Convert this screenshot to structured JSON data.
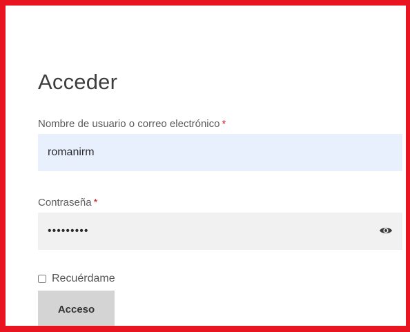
{
  "form": {
    "title": "Acceder",
    "username": {
      "label": "Nombre de usuario o correo electrónico",
      "required_mark": "*",
      "value": "romanirm"
    },
    "password": {
      "label": "Contraseña",
      "required_mark": "*",
      "masked_value": "•••••••••",
      "toggle_icon": "eye-icon"
    },
    "remember": {
      "label": "Recuérdame",
      "checked": false
    },
    "submit_label": "Acceso"
  },
  "colors": {
    "frame_border": "#e8141f",
    "required_mark": "#d4232b",
    "autofill_background": "#e8f0fe",
    "password_background": "#f1f1f1",
    "button_background": "#d4d4d4"
  }
}
